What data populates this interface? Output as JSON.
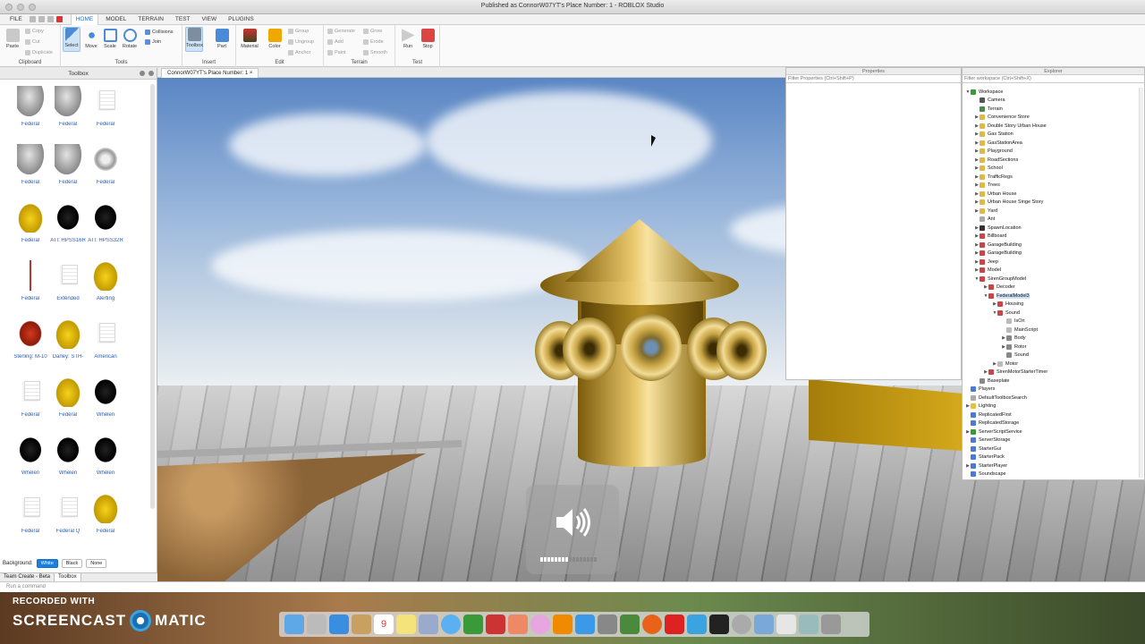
{
  "window": {
    "title": "Published as ConnorW07YT's Place Number: 1 - ROBLOX Studio"
  },
  "menu": [
    "FILE",
    "HOME",
    "MODEL",
    "TERRAIN",
    "TEST",
    "VIEW",
    "PLUGINS"
  ],
  "ribbon": {
    "clipboard": {
      "label": "Clipboard",
      "paste": "Paste",
      "copy": "Copy",
      "cut": "Cut",
      "duplicate": "Duplicate"
    },
    "tools": {
      "label": "Tools",
      "select": "Select",
      "move": "Move",
      "scale": "Scale",
      "rotate": "Rotate",
      "collisions": "Collisions",
      "join": "Join"
    },
    "insert": {
      "label": "Insert",
      "toolbox": "Toolbox",
      "part": "Part"
    },
    "edit": {
      "label": "Edit",
      "material": "Material",
      "color": "Color",
      "group": "Group",
      "ungroup": "Ungroup",
      "anchor": "Anchor"
    },
    "terrain": {
      "label": "Terrain",
      "generate": "Generate",
      "add": "Add",
      "paint": "Paint",
      "grow": "Grow",
      "erode": "Erode",
      "smooth": "Smooth"
    },
    "test": {
      "label": "Test",
      "run": "Run",
      "stop": "Stop"
    }
  },
  "toolbox": {
    "title": "Toolbox",
    "items": [
      {
        "label": "Federal",
        "thumb": "metal"
      },
      {
        "label": "Federal",
        "thumb": "metal"
      },
      {
        "label": "Federal",
        "thumb": "paper"
      },
      {
        "label": "Federal",
        "thumb": "metal"
      },
      {
        "label": "Federal",
        "thumb": "metal"
      },
      {
        "label": "Federal",
        "thumb": "disc"
      },
      {
        "label": "Federal",
        "thumb": "yellow"
      },
      {
        "label": "ATI: HPSS16R",
        "thumb": "black"
      },
      {
        "label": "ATI: HPSS32R",
        "thumb": "black"
      },
      {
        "label": "Federal",
        "thumb": "pole"
      },
      {
        "label": "Extended",
        "thumb": "paper"
      },
      {
        "label": "Alerting",
        "thumb": "yellow"
      },
      {
        "label": "Sterling: M-10",
        "thumb": "red"
      },
      {
        "label": "Darley: STH-",
        "thumb": "yellow"
      },
      {
        "label": "American",
        "thumb": "paper"
      },
      {
        "label": "Federal",
        "thumb": "paper"
      },
      {
        "label": "Federal",
        "thumb": "yellow"
      },
      {
        "label": "Whelen",
        "thumb": "black"
      },
      {
        "label": "Whelen",
        "thumb": "black"
      },
      {
        "label": "Whelen",
        "thumb": "black"
      },
      {
        "label": "Whelen",
        "thumb": "black"
      },
      {
        "label": "Federal",
        "thumb": "paper"
      },
      {
        "label": "Federal Q",
        "thumb": "paper"
      },
      {
        "label": "Federal",
        "thumb": "yellow"
      }
    ],
    "background_label": "Background:",
    "bg_white": "White",
    "bg_black": "Black",
    "bg_none": "None"
  },
  "bottom_tabs": [
    "Team Create - Beta",
    "Toolbox"
  ],
  "viewport": {
    "tab": "ConnorW07YT's Place Number: 1"
  },
  "properties": {
    "title": "Properties",
    "filter_placeholder": "Filter Properties (Ctrl+Shift+P)"
  },
  "explorer": {
    "title": "Explorer",
    "filter_placeholder": "Filter workspace (Ctrl+Shift+X)",
    "nodes": [
      {
        "label": "Workspace",
        "level": 0,
        "arrow": "▼",
        "icon": "#3a9a3a"
      },
      {
        "label": "Camera",
        "level": 1,
        "arrow": "",
        "icon": "#555"
      },
      {
        "label": "Terrain",
        "level": 1,
        "arrow": "",
        "icon": "#4a8a4a"
      },
      {
        "label": "Convenience Store",
        "level": 1,
        "arrow": "▶",
        "icon": "#e0b84a"
      },
      {
        "label": "Double Story Urban House",
        "level": 1,
        "arrow": "▶",
        "icon": "#e0b84a"
      },
      {
        "label": "Gas Station",
        "level": 1,
        "arrow": "▶",
        "icon": "#e0b84a"
      },
      {
        "label": "GasStationArea",
        "level": 1,
        "arrow": "▶",
        "icon": "#e0b84a"
      },
      {
        "label": "Playground",
        "level": 1,
        "arrow": "▶",
        "icon": "#e0b84a"
      },
      {
        "label": "RoadSections",
        "level": 1,
        "arrow": "▶",
        "icon": "#e0b84a"
      },
      {
        "label": "School",
        "level": 1,
        "arrow": "▶",
        "icon": "#e0b84a"
      },
      {
        "label": "TrafficRegs",
        "level": 1,
        "arrow": "▶",
        "icon": "#e0b84a"
      },
      {
        "label": "Trees",
        "level": 1,
        "arrow": "▶",
        "icon": "#e0b84a"
      },
      {
        "label": "Urban House",
        "level": 1,
        "arrow": "▶",
        "icon": "#e0b84a"
      },
      {
        "label": "Urban House Singe Story",
        "level": 1,
        "arrow": "▶",
        "icon": "#e0b84a"
      },
      {
        "label": "Yard",
        "level": 1,
        "arrow": "▶",
        "icon": "#e0b84a"
      },
      {
        "label": "Ant",
        "level": 1,
        "arrow": "",
        "icon": "#aaa"
      },
      {
        "label": "SpawnLocation",
        "level": 1,
        "arrow": "▶",
        "icon": "#333"
      },
      {
        "label": "Billboard",
        "level": 1,
        "arrow": "▶",
        "icon": "#c44"
      },
      {
        "label": "GarageBuilding",
        "level": 1,
        "arrow": "▶",
        "icon": "#c44"
      },
      {
        "label": "GarageBuilding",
        "level": 1,
        "arrow": "▶",
        "icon": "#c44"
      },
      {
        "label": "Jeep",
        "level": 1,
        "arrow": "▶",
        "icon": "#c44"
      },
      {
        "label": "Model",
        "level": 1,
        "arrow": "▶",
        "icon": "#c44"
      },
      {
        "label": "SirenGroupModel",
        "level": 1,
        "arrow": "▼",
        "icon": "#c44"
      },
      {
        "label": "Decoder",
        "level": 2,
        "arrow": "▶",
        "icon": "#c44"
      },
      {
        "label": "FederalModel3",
        "level": 2,
        "arrow": "▼",
        "icon": "#c44",
        "selected": true
      },
      {
        "label": "Housing",
        "level": 3,
        "arrow": "▶",
        "icon": "#c44"
      },
      {
        "label": "Sound",
        "level": 3,
        "arrow": "▼",
        "icon": "#c44"
      },
      {
        "label": "IsOn",
        "level": 4,
        "arrow": "",
        "icon": "#bbb"
      },
      {
        "label": "MainScript",
        "level": 4,
        "arrow": "",
        "icon": "#bbb"
      },
      {
        "label": "Body",
        "level": 4,
        "arrow": "▶",
        "icon": "#888"
      },
      {
        "label": "Rotor",
        "level": 4,
        "arrow": "▶",
        "icon": "#888"
      },
      {
        "label": "Sound",
        "level": 4,
        "arrow": "",
        "icon": "#888"
      },
      {
        "label": "Motor",
        "level": 3,
        "arrow": "▶",
        "icon": "#bbb"
      },
      {
        "label": "SirenMotorStarterTimer",
        "level": 2,
        "arrow": "▶",
        "icon": "#c44"
      },
      {
        "label": "Baseplate",
        "level": 1,
        "arrow": "",
        "icon": "#888"
      },
      {
        "label": "Players",
        "level": 0,
        "arrow": "",
        "icon": "#4a7ad6"
      },
      {
        "label": "DefaultToolboxSearch",
        "level": 0,
        "arrow": "",
        "icon": "#aaa"
      },
      {
        "label": "Lighting",
        "level": 0,
        "arrow": "▶",
        "icon": "#e8c13a"
      },
      {
        "label": "ReplicatedFirst",
        "level": 0,
        "arrow": "",
        "icon": "#4a7ad6"
      },
      {
        "label": "ReplicatedStorage",
        "level": 0,
        "arrow": "",
        "icon": "#4a7ad6"
      },
      {
        "label": "ServerScriptService",
        "level": 0,
        "arrow": "▶",
        "icon": "#3a9a3a"
      },
      {
        "label": "ServerStorage",
        "level": 0,
        "arrow": "",
        "icon": "#4a7ad6"
      },
      {
        "label": "StarterGui",
        "level": 0,
        "arrow": "",
        "icon": "#4a7ad6"
      },
      {
        "label": "StarterPack",
        "level": 0,
        "arrow": "",
        "icon": "#4a7ad6"
      },
      {
        "label": "StarterPlayer",
        "level": 0,
        "arrow": "▶",
        "icon": "#4a7ad6"
      },
      {
        "label": "Soundscape",
        "level": 0,
        "arrow": "",
        "icon": "#4a7ad6"
      }
    ]
  },
  "command_bar": {
    "placeholder": "Run a command"
  },
  "volume": {
    "level": 0.5
  },
  "watermark": {
    "line1": "RECORDED WITH",
    "line2a": "SCREENCAST",
    "line2b": "MATIC"
  },
  "dock": {
    "calendar_day": "9"
  }
}
